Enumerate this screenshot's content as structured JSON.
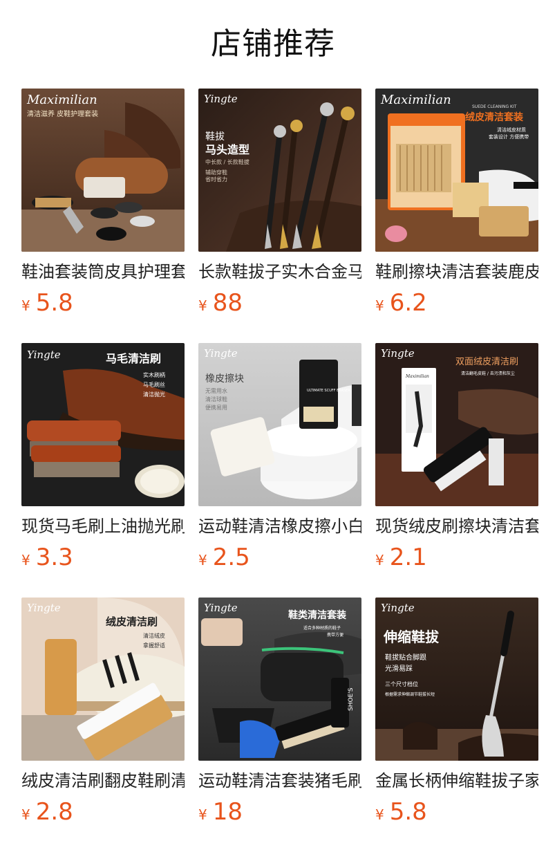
{
  "section_title": "店铺推荐",
  "currency_symbol": "¥",
  "accent_color": "#e8541c",
  "products": [
    {
      "name": "鞋油套装筒皮具护理套装",
      "price": "5.8",
      "image": {
        "brand": "Maximilian",
        "headline": "清洁滋养 皮鞋护理套装",
        "sub": "",
        "kind": "kit-on-wood"
      }
    },
    {
      "name": "长款鞋拔子实木合金马头",
      "price": "88",
      "image": {
        "brand": "Yingte",
        "headline": "鞋拔",
        "headline2": "马头造型",
        "sub": "中长款 / 长款鞋拔",
        "sub2": "辅助穿鞋",
        "sub3": "省时省力",
        "kind": "horn-shoehorns"
      }
    },
    {
      "name": "鞋刷擦块清洁套装鹿皮",
      "price": "6.2",
      "image": {
        "brand": "Maximilian",
        "headline": "绒皮清洁套装",
        "sub": "SUEDE CLEANING KIT",
        "sub2": "清洁绒皮材质",
        "sub3": "套装设计 方便携带",
        "kind": "suede-kit"
      }
    },
    {
      "name": "现货马毛刷上油抛光刷",
      "price": "3.3",
      "image": {
        "brand": "Yingte",
        "headline": "马毛清洁刷",
        "sub": "实木刷柄",
        "sub2": "马毛刷丝",
        "sub3": "清洁抛光",
        "kind": "horsehair-brush"
      }
    },
    {
      "name": "运动鞋清洁橡皮擦小白鞋",
      "price": "2.5",
      "image": {
        "brand": "Yingte",
        "headline": "橡皮擦块",
        "sub": "无需用水",
        "sub2": "清洁球鞋",
        "sub3": "便携易用",
        "box": "ULTIMATE SCUFF ERASER",
        "kind": "eraser"
      }
    },
    {
      "name": "现货绒皮刷擦块清洁套装",
      "price": "2.1",
      "image": {
        "brand": "Yingte",
        "headline": "双面绒皮清洁刷",
        "sub": "清洁翻毛皮鞋 / 去污渍和灰尘",
        "box": "Maximilian",
        "kind": "double-brush"
      }
    },
    {
      "name": "绒皮清洁刷翻皮鞋刷清洁",
      "price": "2.8",
      "image": {
        "brand": "Yingte",
        "headline": "绒皮清洁刷",
        "sub": "清洁绒皮",
        "sub2": "拿握舒适",
        "kind": "suede-brush"
      }
    },
    {
      "name": "运动鞋清洁套装猪毛刷",
      "price": "18",
      "image": {
        "brand": "Yingte",
        "headline": "鞋类清洁套装",
        "sub": "适合多种材质的鞋子",
        "sub2": "携带方便",
        "bottle": "SHOE'S",
        "kind": "sneaker-kit"
      }
    },
    {
      "name": "金属长柄伸缩鞋拔子家用",
      "price": "5.8",
      "image": {
        "brand": "Yingte",
        "headline": "伸缩鞋拔",
        "sub": "鞋拔贴合脚跟",
        "sub2": "光滑易踩",
        "sub3": "三个尺寸档位",
        "sub4": "根据需求伸缩调节鞋拔长短",
        "kind": "telescopic"
      }
    }
  ]
}
